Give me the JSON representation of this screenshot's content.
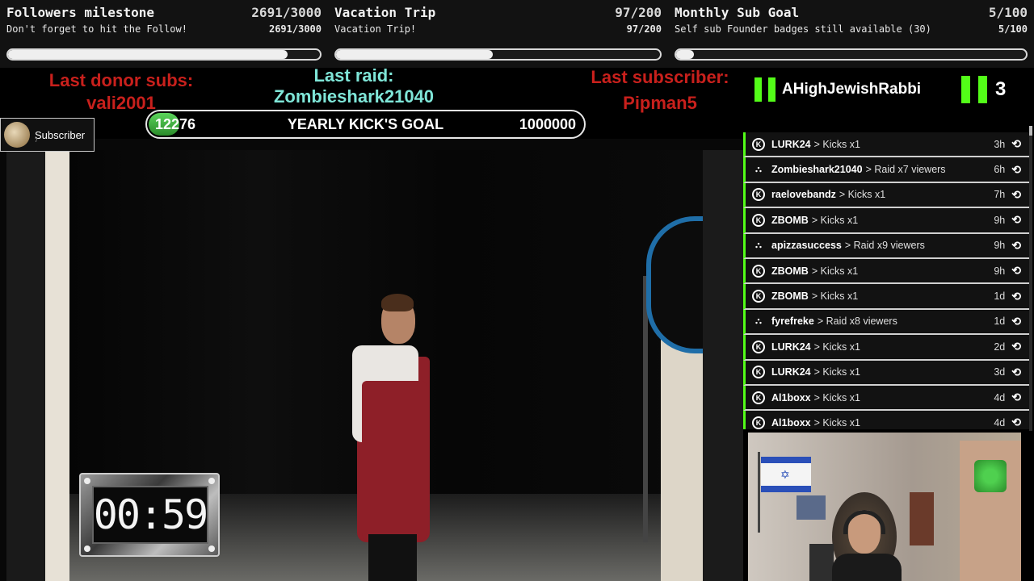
{
  "goals": [
    {
      "title": "Followers milestone",
      "count": "2691/3000",
      "subtitle": "Don't forget to hit the Follow!",
      "subcount": "2691/3000",
      "progress": 0.897
    },
    {
      "title": "Vacation Trip",
      "count": "97/200",
      "subtitle": "Vacation Trip!",
      "subcount": "97/200",
      "progress": 0.485
    },
    {
      "title": "Monthly Sub Goal",
      "count": "5/100",
      "subtitle": "Self sub Founder badges still available (30)",
      "subcount": "5/100",
      "progress": 0.05
    }
  ],
  "info": {
    "last_donor_label": "Last donor subs:",
    "last_donor_name": "vali2001",
    "last_raid_label": "Last raid:",
    "last_raid_name": "Zombieshark21040",
    "last_sub_label": "Last subscriber:",
    "last_sub_name": "Pipman5"
  },
  "yearly_goal": {
    "current": "12276",
    "label": "YEARLY KICK'S GOAL",
    "target": "1000000"
  },
  "kick": {
    "username": "AHighJewishRabbi",
    "count": "3"
  },
  "subscriber_chip": {
    "label": "Subscriber",
    "small": "7"
  },
  "timer": {
    "value": "00:59"
  },
  "events": [
    {
      "icon": "kick",
      "name": "LURK24",
      "action": "> Kicks x1",
      "time": "3h"
    },
    {
      "icon": "raid",
      "name": "Zombieshark21040",
      "action": "> Raid x7 viewers",
      "time": "6h"
    },
    {
      "icon": "kick",
      "name": "raelovebandz",
      "action": "> Kicks x1",
      "time": "7h"
    },
    {
      "icon": "kick",
      "name": "ZBOMB",
      "action": "> Kicks x1",
      "time": "9h"
    },
    {
      "icon": "raid",
      "name": "apizzasuccess",
      "action": "> Raid x9 viewers",
      "time": "9h"
    },
    {
      "icon": "kick",
      "name": "ZBOMB",
      "action": "> Kicks x1",
      "time": "9h"
    },
    {
      "icon": "kick",
      "name": "ZBOMB",
      "action": "> Kicks x1",
      "time": "1d"
    },
    {
      "icon": "raid",
      "name": "fyrefreke",
      "action": "> Raid x8 viewers",
      "time": "1d"
    },
    {
      "icon": "kick",
      "name": "LURK24",
      "action": "> Kicks x1",
      "time": "2d"
    },
    {
      "icon": "kick",
      "name": "LURK24",
      "action": "> Kicks x1",
      "time": "3d"
    },
    {
      "icon": "kick",
      "name": "Al1boxx",
      "action": "> Kicks x1",
      "time": "4d"
    },
    {
      "icon": "kick",
      "name": "Al1boxx",
      "action": "> Kicks x1",
      "time": "4d"
    }
  ],
  "colors": {
    "kick_green": "#53fc18",
    "label_red": "#c8201c",
    "label_cyan": "#7fe6d8"
  }
}
